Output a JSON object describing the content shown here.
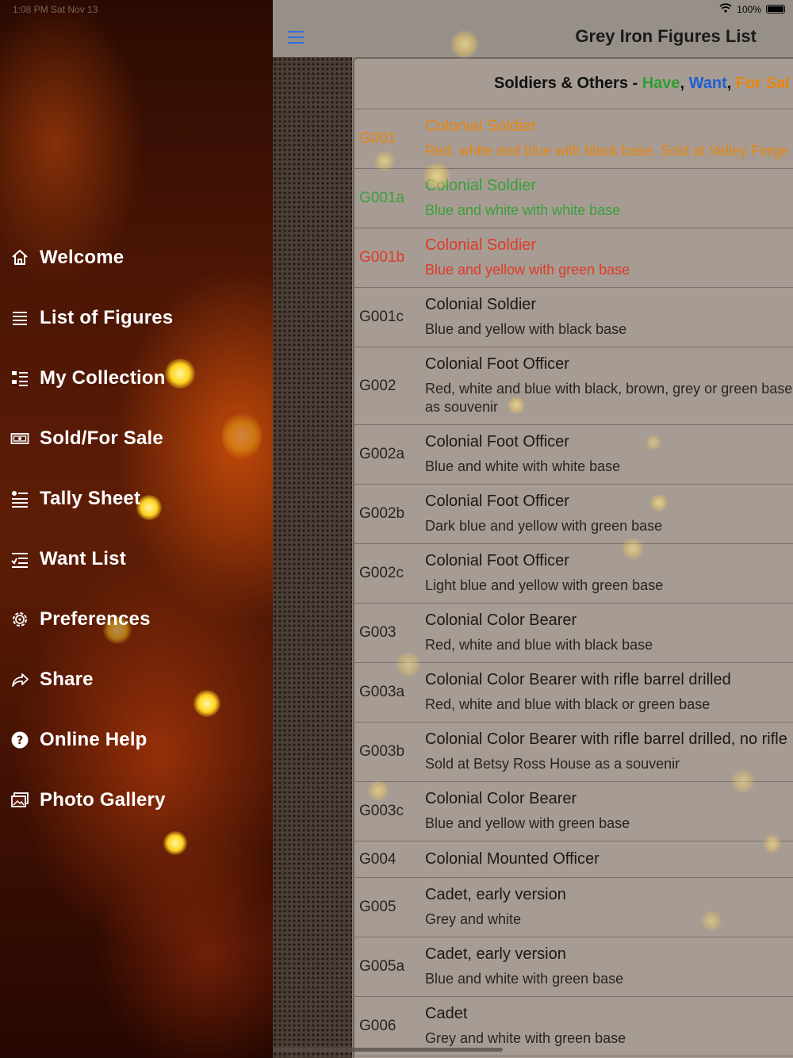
{
  "status_bar": {
    "time": "1:08 PM  Sat Nov 13",
    "battery": "100%"
  },
  "sidebar": {
    "items": [
      {
        "label": "Welcome",
        "icon": "house-icon"
      },
      {
        "label": "List of Figures",
        "icon": "list-icon"
      },
      {
        "label": "My Collection",
        "icon": "checklist-icon"
      },
      {
        "label": "Sold/For Sale",
        "icon": "banknote-icon"
      },
      {
        "label": "Tally Sheet",
        "icon": "tally-icon"
      },
      {
        "label": "Want List",
        "icon": "want-list-icon"
      },
      {
        "label": "Preferences",
        "icon": "gear-icon"
      },
      {
        "label": "Share",
        "icon": "share-arrow-icon"
      },
      {
        "label": "Online Help",
        "icon": "question-icon"
      },
      {
        "label": "Photo Gallery",
        "icon": "photos-icon"
      }
    ]
  },
  "navbar": {
    "title": "Grey Iron Figures List"
  },
  "list": {
    "header": {
      "prefix": "Soldiers & Others - ",
      "have": "Have",
      "comma1": ", ",
      "want": "Want",
      "comma2": ", ",
      "for_sale": "For Sal"
    },
    "colors": {
      "have": "#3aa03a",
      "want": "#1f5ed6",
      "for_sale": "#e8850f",
      "sold": "#e03a28"
    },
    "rows": [
      {
        "code": "G001",
        "name": "Colonial Soldier",
        "desc": [
          "Red, white and blue with black base. Sold at Valley Forge"
        ],
        "status": "orange"
      },
      {
        "code": "G001a",
        "name": "Colonial Soldier",
        "desc": [
          "Blue and white with white base"
        ],
        "status": "green"
      },
      {
        "code": "G001b",
        "name": "Colonial Soldier",
        "desc": [
          "Blue and yellow with green base"
        ],
        "status": "red"
      },
      {
        "code": "G001c",
        "name": "Colonial Soldier",
        "desc": [
          "Blue and yellow with black base"
        ],
        "status": ""
      },
      {
        "code": "G002",
        "name": "Colonial Foot Officer",
        "desc": [
          "Red, white and blue with black, brown, grey or green base",
          "as souvenir"
        ],
        "status": ""
      },
      {
        "code": "G002a",
        "name": "Colonial Foot Officer",
        "desc": [
          "Blue and white with white base"
        ],
        "status": ""
      },
      {
        "code": "G002b",
        "name": "Colonial Foot Officer",
        "desc": [
          "Dark blue and yellow with green base"
        ],
        "status": ""
      },
      {
        "code": "G002c",
        "name": "Colonial Foot Officer",
        "desc": [
          "Light blue and yellow with green base"
        ],
        "status": ""
      },
      {
        "code": "G003",
        "name": "Colonial Color Bearer",
        "desc": [
          "Red, white and blue with black base"
        ],
        "status": ""
      },
      {
        "code": "G003a",
        "name": "Colonial Color Bearer with rifle barrel drilled",
        "desc": [
          "Red, white and blue with black or green base"
        ],
        "status": ""
      },
      {
        "code": "G003b",
        "name": "Colonial Color Bearer with rifle barrel drilled, no rifle",
        "desc": [
          "Sold at Betsy Ross House as a souvenir"
        ],
        "status": ""
      },
      {
        "code": "G003c",
        "name": "Colonial Color Bearer",
        "desc": [
          "Blue and yellow with green base"
        ],
        "status": ""
      },
      {
        "code": "G004",
        "name": "Colonial Mounted Officer",
        "desc": [],
        "status": ""
      },
      {
        "code": "G005",
        "name": "Cadet, early version",
        "desc": [
          "Grey and white"
        ],
        "status": ""
      },
      {
        "code": "G005a",
        "name": "Cadet, early version",
        "desc": [
          "Blue and white with green base"
        ],
        "status": ""
      },
      {
        "code": "G006",
        "name": "Cadet",
        "desc": [
          "Grey and white with green base"
        ],
        "status": ""
      }
    ]
  }
}
